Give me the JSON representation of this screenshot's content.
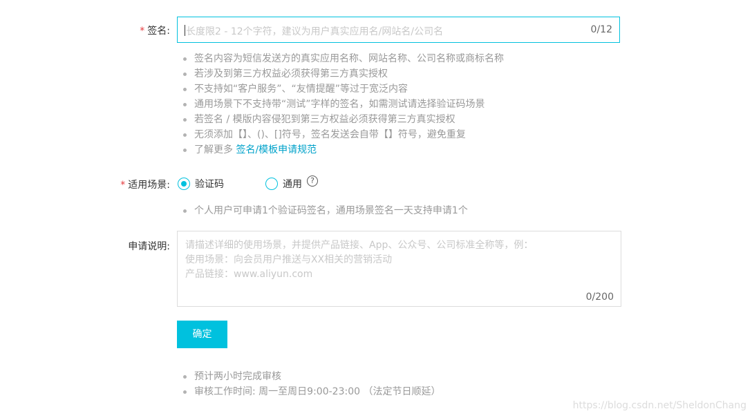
{
  "signature": {
    "label": "签名:",
    "required_mark": "*",
    "placeholder": "长度限2 - 12个字符，建议为用户真实应用名/网站名/公司名",
    "counter": "0/12",
    "tips": [
      "签名内容为短信发送方的真实应用名称、网站名称、公司名称或商标名称",
      "若涉及到第三方权益必须获得第三方真实授权",
      "不支持如“客户服务”、“友情提醒”等过于宽泛内容",
      "通用场景下不支持带“测试”字样的签名，如需测试请选择验证码场景",
      "若签名 / 模版内容侵犯到第三方权益必须获得第三方真实授权",
      "无须添加【】、()、[]符号，签名发送会自带【】符号，避免重复"
    ],
    "learn_more_prefix": "了解更多",
    "learn_more_link": "签名/模板申请规范"
  },
  "scene": {
    "label": "适用场景:",
    "required_mark": "*",
    "options": [
      {
        "label": "验证码",
        "selected": true
      },
      {
        "label": "通用",
        "selected": false
      }
    ],
    "help_icon": "question-circle-icon",
    "help_glyph": "?",
    "tip": "个人用户可申请1个验证码签名，通用场景签名一天支持申请1个"
  },
  "description": {
    "label": "申请说明:",
    "placeholder_lines": [
      "请描述详细的使用场景，并提供产品链接、App、公众号、公司标准全称等，例：",
      "使用场景：向会员用户推送与XX相关的营销活动",
      "产品链接：www.aliyun.com"
    ],
    "counter": "0/200"
  },
  "submit": {
    "label": "确定"
  },
  "footer_tips": [
    "预计两小时完成审核",
    "审核工作时间: 周一至周日9:00-23:00 （法定节日顺延）"
  ],
  "watermark": "https://blog.csdn.net/SheldonChang",
  "colors": {
    "accent": "#00c1de",
    "required": "#e4393c",
    "link": "#00a2ca",
    "tip_text": "#999999"
  }
}
